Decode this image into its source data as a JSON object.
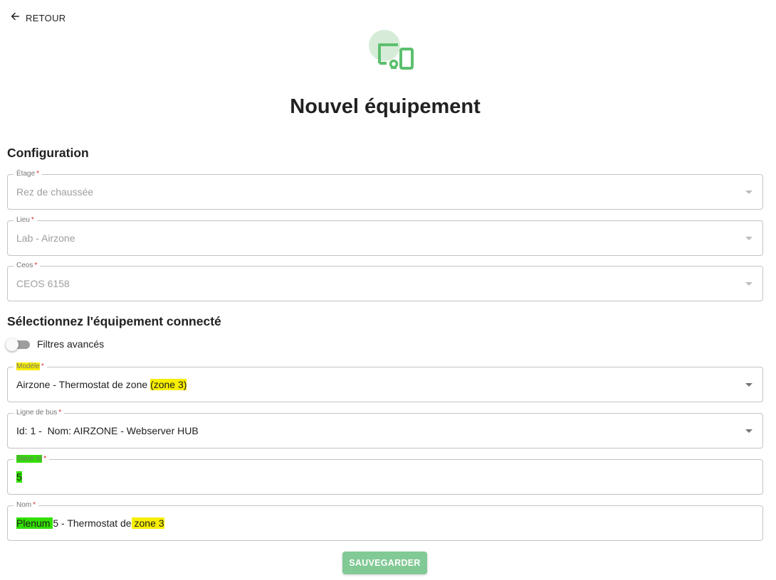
{
  "nav": {
    "back_label": "RETOUR",
    "back_icon": "arrow-left-icon"
  },
  "hero": {
    "icon": "devices-icon",
    "color": "#5cbf6e",
    "bg_color": "#d6ecd8"
  },
  "page": {
    "title": "Nouvel équipement"
  },
  "configuration": {
    "title": "Configuration",
    "fields": [
      {
        "label": "Étage",
        "required": "*",
        "value": "Rez de chaussée"
      },
      {
        "label": "Lieu",
        "required": "*",
        "value": "Lab - Airzone"
      },
      {
        "label": "Ceos",
        "required": "*",
        "value": "CEOS 6158"
      }
    ]
  },
  "connected": {
    "title": "Sélectionnez l'équipement connecté",
    "advanced_filters_label": "Filtres avancés",
    "advanced_filters_on": false,
    "modele": {
      "label": "Modèle",
      "required": "*",
      "value_prefix": "Airzone - Thermostat de zone ",
      "value_highlight": "(zone 3)"
    },
    "bus": {
      "label": "Ligne de bus",
      "required": "*",
      "value": "Id: 1 -  Nom: AIRZONE - Webserver HUB"
    },
    "slave": {
      "label": "Slave Id",
      "required": "*",
      "value": "5"
    },
    "nom": {
      "label": "Nom",
      "required": "*",
      "value_highlight_1": "Plenum ",
      "value_mid": "5 - Thermostat de",
      "value_highlight_2": " zone 3"
    }
  },
  "actions": {
    "save_label": "SAUVEGARDER",
    "save_color": "#81c995"
  },
  "colors": {
    "highlight_yellow": "#f7ee00",
    "highlight_green": "#31e000",
    "required_star": "#d32f2f"
  }
}
